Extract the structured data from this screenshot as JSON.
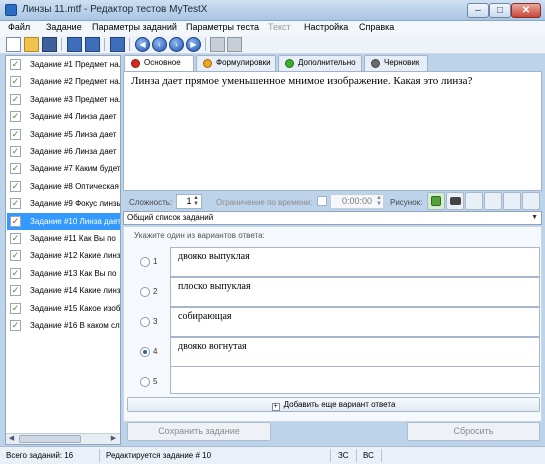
{
  "window": {
    "title": "Линзы 11.mtf - Редактор тестов MyTestX",
    "buttons": {
      "minimize": "–",
      "maximize": "□",
      "close": "✕"
    }
  },
  "menu": [
    {
      "label": "Файл",
      "disabled": false
    },
    {
      "label": "Задание",
      "disabled": false
    },
    {
      "label": "Параметры заданий",
      "disabled": false
    },
    {
      "label": "Параметры теста",
      "disabled": false
    },
    {
      "label": "Текст",
      "disabled": true
    },
    {
      "label": "Настройка",
      "disabled": false
    },
    {
      "label": "Справка",
      "disabled": false
    }
  ],
  "toolbar": {
    "icons": [
      "new-document-icon",
      "open-folder-icon",
      "save-icon",
      "add-task-icon",
      "delete-task-icon",
      "task-properties-icon",
      "nav-first-icon",
      "nav-prev-icon",
      "nav-next-icon",
      "nav-last-icon",
      "copy-icon",
      "paste-icon"
    ],
    "nav_glyphs": [
      "◀",
      "‹",
      "›",
      "▶"
    ]
  },
  "tasks": [
    {
      "label": "Задание #1 Предмет на..."
    },
    {
      "label": "Задание #2 Предмет на..."
    },
    {
      "label": "Задание #3 Предмет на..."
    },
    {
      "label": "Задание #4 Линза дает"
    },
    {
      "label": "Задание #5 Линза дает"
    },
    {
      "label": "Задание #6 Линза дает"
    },
    {
      "label": "Задание #7 Каким будет"
    },
    {
      "label": "Задание #8 Оптическая"
    },
    {
      "label": "Задание #9 Фокус линзы"
    },
    {
      "label": "Задание #10 Линза дает",
      "selected": true
    },
    {
      "label": "Задание #11 Как Вы по"
    },
    {
      "label": "Задание #12 Какие линз"
    },
    {
      "label": "Задание #13 Как Вы по"
    },
    {
      "label": "Задание #14 Какие линз"
    },
    {
      "label": "Задание #15 Какое изоб"
    },
    {
      "label": "Задание #16 В каком слу"
    }
  ],
  "tabs": [
    {
      "label": "Основное",
      "color": "#d62a20",
      "active": true
    },
    {
      "label": "Формулировки",
      "color": "#f0a417",
      "active": false
    },
    {
      "label": "Дополнительно",
      "color": "#3aae2a",
      "active": false
    },
    {
      "label": "Черновик",
      "color": "#6b6b6b",
      "active": false
    }
  ],
  "question": {
    "text": "Линза дает прямое уменьшенное мнимое изображение. Какая это линза?"
  },
  "settings": {
    "complexity_label": "Сложность:",
    "complexity_value": "1",
    "time_limit_label": "Ограничение по времени:",
    "time_limit_enabled": false,
    "time_value": "0:00:00",
    "picture_label": "Рисунок:"
  },
  "task_type": {
    "selected": "Общий список заданий"
  },
  "answers": {
    "hint": "Укажите один из вариантов ответа:",
    "selected_index": 3,
    "options": [
      {
        "num": "1",
        "text": "двояко выпуклая"
      },
      {
        "num": "2",
        "text": "плоско выпуклая"
      },
      {
        "num": "3",
        "text": "собирающая"
      },
      {
        "num": "4",
        "text": "двояко вогнутая"
      },
      {
        "num": "5",
        "text": ""
      }
    ],
    "add_label": "Добавить еще вариант ответа"
  },
  "buttons": {
    "save_task": "Сохранить задание",
    "reset": "Сбросить"
  },
  "status": {
    "total": "Всего заданий: 16",
    "editing": "Редактируется задание # 10",
    "mode1": "ЗС",
    "mode2": "ВС"
  }
}
